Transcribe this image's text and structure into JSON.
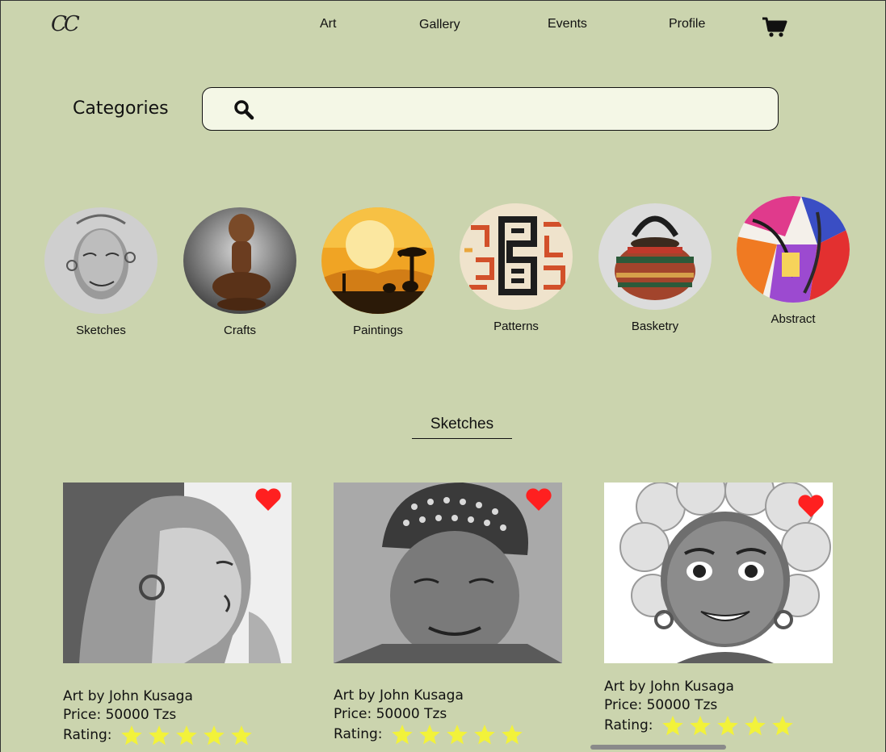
{
  "header": {
    "logo": "CC",
    "nav": [
      "Art",
      "Gallery",
      "Events",
      "Profile"
    ]
  },
  "search": {
    "title": "Categories",
    "placeholder": ""
  },
  "categories": [
    "Sketches",
    "Crafts",
    "Paintings",
    "Patterns",
    "Basketry",
    "Abstract"
  ],
  "section": {
    "title": "Sketches"
  },
  "cards": [
    {
      "artist": "Art by John Kusaga",
      "price": "Price: 50000 Tzs",
      "rating_label": "Rating:",
      "stars": 5
    },
    {
      "artist": "Art by John Kusaga",
      "price": "Price: 50000 Tzs",
      "rating_label": "Rating:",
      "stars": 5
    },
    {
      "artist": "Art by John Kusaga",
      "price": "Price: 50000 Tzs",
      "rating_label": "Rating:",
      "stars": 5
    }
  ],
  "colors": {
    "background": "#cbd4ae",
    "search_bg": "#f4f7e6",
    "heart": "#ff2020",
    "star": "#f2f23a"
  },
  "icons": {
    "cart": "cart-icon",
    "search": "search-icon",
    "favorite": "heart-icon",
    "rating": "star-icon"
  }
}
